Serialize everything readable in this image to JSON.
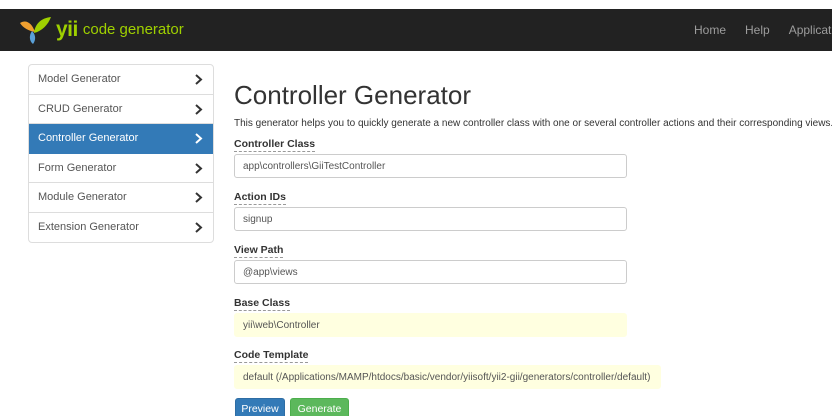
{
  "navbar": {
    "brand_yii": "yii",
    "brand_text": "code generator",
    "links": [
      "Home",
      "Help",
      "Application"
    ]
  },
  "sidebar": {
    "items": [
      {
        "label": "Model Generator",
        "active": false
      },
      {
        "label": "CRUD Generator",
        "active": false
      },
      {
        "label": "Controller Generator",
        "active": true
      },
      {
        "label": "Form Generator",
        "active": false
      },
      {
        "label": "Module Generator",
        "active": false
      },
      {
        "label": "Extension Generator",
        "active": false
      }
    ]
  },
  "main": {
    "title": "Controller Generator",
    "description": "This generator helps you to quickly generate a new controller class with one or several controller actions and their corresponding views.",
    "fields": {
      "controller_class": {
        "label": "Controller Class",
        "value": "app\\controllers\\GiiTestController"
      },
      "action_ids": {
        "label": "Action IDs",
        "value": "signup"
      },
      "view_path": {
        "label": "View Path",
        "value": "@app\\views"
      },
      "base_class": {
        "label": "Base Class",
        "value": "yii\\web\\Controller"
      },
      "code_template": {
        "label": "Code Template",
        "value": "default (/Applications/MAMP/htdocs/basic/vendor/yiisoft/yii2-gii/generators/controller/default)"
      }
    },
    "buttons": {
      "preview": "Preview",
      "generate": "Generate"
    }
  },
  "colors": {
    "navbar_bg": "#222222",
    "brand_green": "#9fd000",
    "active_blue": "#337ab7",
    "generate_green": "#5cb85c",
    "sticky_yellow": "#ffffe0"
  }
}
